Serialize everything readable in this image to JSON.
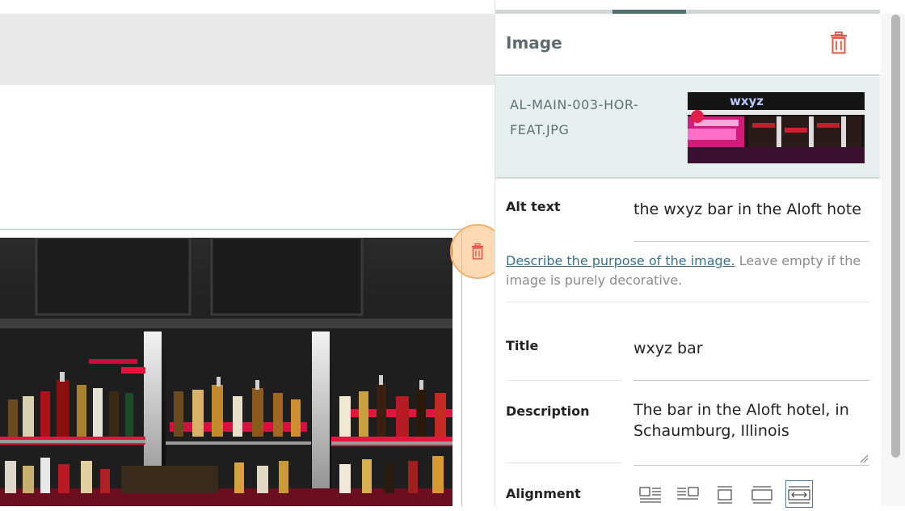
{
  "canvas": {
    "block_delete_icon": "trash-icon"
  },
  "panel": {
    "title": "Image",
    "delete_icon": "trash-icon",
    "file": {
      "name": "AL-MAIN-003-HOR-FEAT.JPG",
      "thumbnail_text": "wxyz"
    },
    "alt_text": {
      "label": "Alt text",
      "value": "the wxyz bar in the Aloft hote"
    },
    "help": {
      "link": "Describe the purpose of the image.",
      "rest": " Leave empty if the image is purely decorative."
    },
    "title_field": {
      "label": "Title",
      "value": "wxyz bar"
    },
    "description": {
      "label": "Description",
      "value": "The bar in the Aloft hotel, in Schaumburg, Illinois"
    },
    "alignment": {
      "label": "Alignment",
      "options": [
        "align-left",
        "align-right",
        "align-center",
        "align-wide",
        "align-full"
      ],
      "selected": "align-full"
    }
  },
  "colors": {
    "accent": "#4f6f70",
    "delete": "#e0574b",
    "highlight": "#f4b06a"
  }
}
